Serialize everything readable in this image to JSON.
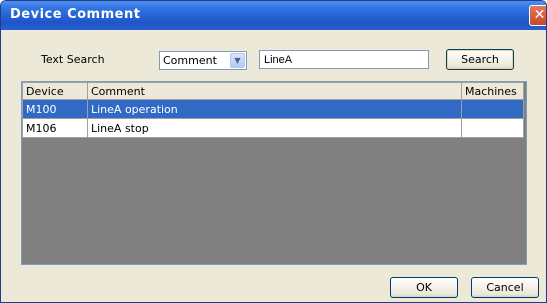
{
  "window": {
    "title": "Device Comment",
    "close_glyph": "✕"
  },
  "search": {
    "label": "Text Search",
    "field_selected": "Comment",
    "field_arrow": "▼",
    "text_value": "LineA",
    "button_label": "Search"
  },
  "table": {
    "columns": [
      "Device",
      "Comment",
      "Machines"
    ],
    "rows": [
      {
        "device": "M100",
        "comment": "LineA operation",
        "machines": ""
      },
      {
        "device": "M106",
        "comment": "LineA stop",
        "machines": ""
      }
    ],
    "selected_row": 0
  },
  "footer": {
    "ok_label": "OK",
    "cancel_label": "Cancel"
  },
  "colors": {
    "titlebar": "#2f6fe0",
    "selection": "#316ac5",
    "grid_background": "#808080",
    "dialog_background": "#ece9d8"
  },
  "icons": {
    "close": "close-icon",
    "dropdown": "chevron-down-icon"
  }
}
